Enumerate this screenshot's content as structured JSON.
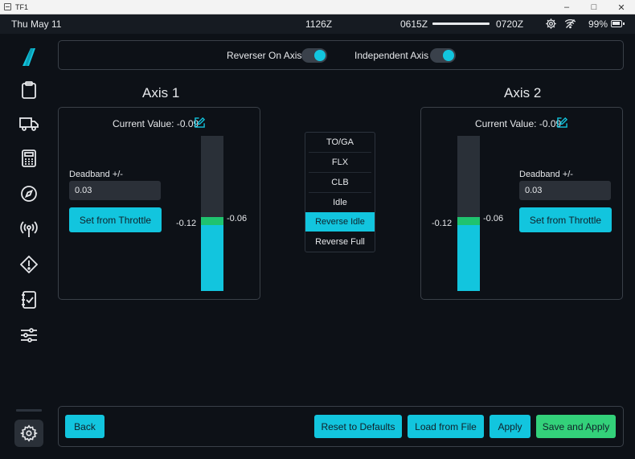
{
  "window": {
    "title": "TF1",
    "controls": [
      "minimize",
      "maximize",
      "close"
    ]
  },
  "statusbar": {
    "date": "Thu May 11",
    "utc_time": "1126Z",
    "departure_time": "0615Z",
    "arrival_time": "0720Z",
    "battery": "99%",
    "icons": [
      "gear-icon",
      "wifi-icon",
      "battery-icon"
    ]
  },
  "sidebar": {
    "items": [
      {
        "name": "clipboard-icon"
      },
      {
        "name": "truck-icon"
      },
      {
        "name": "calculator-icon"
      },
      {
        "name": "compass-icon"
      },
      {
        "name": "antenna-icon"
      },
      {
        "name": "warning-icon"
      },
      {
        "name": "checklist-icon"
      },
      {
        "name": "sliders-icon"
      }
    ],
    "settings": {
      "name": "gear-icon",
      "active": true
    }
  },
  "toggles": {
    "reverser_on_axis": {
      "label": "Reverser On Axis",
      "on": true
    },
    "independent_axis": {
      "label": "Independent Axis",
      "on": true
    }
  },
  "axis1": {
    "title": "Axis 1",
    "current_value_text": "Current Value: -0.09",
    "deadband_label": "Deadband +/-",
    "deadband_value": "0.03",
    "set_button": "Set from Throttle",
    "lower_label": "-0.12",
    "upper_label": "-0.06",
    "fill_fraction": 0.44
  },
  "axis2": {
    "title": "Axis 2",
    "current_value_text": "Current Value: -0.09",
    "deadband_label": "Deadband +/-",
    "deadband_value": "0.03",
    "set_button": "Set from Throttle",
    "lower_label": "-0.12",
    "upper_label": "-0.06",
    "fill_fraction": 0.44
  },
  "detents": {
    "items": [
      "TO/GA",
      "FLX",
      "CLB",
      "Idle",
      "Reverse Idle",
      "Reverse Full"
    ],
    "selected": "Reverse Idle"
  },
  "bottom": {
    "back": "Back",
    "reset": "Reset to Defaults",
    "load": "Load from File",
    "apply": "Apply",
    "save_apply": "Save and Apply"
  },
  "colors": {
    "accent": "#12c5de",
    "success": "#33d17a",
    "deadband": "#1fc36f",
    "background": "#0d1117"
  }
}
